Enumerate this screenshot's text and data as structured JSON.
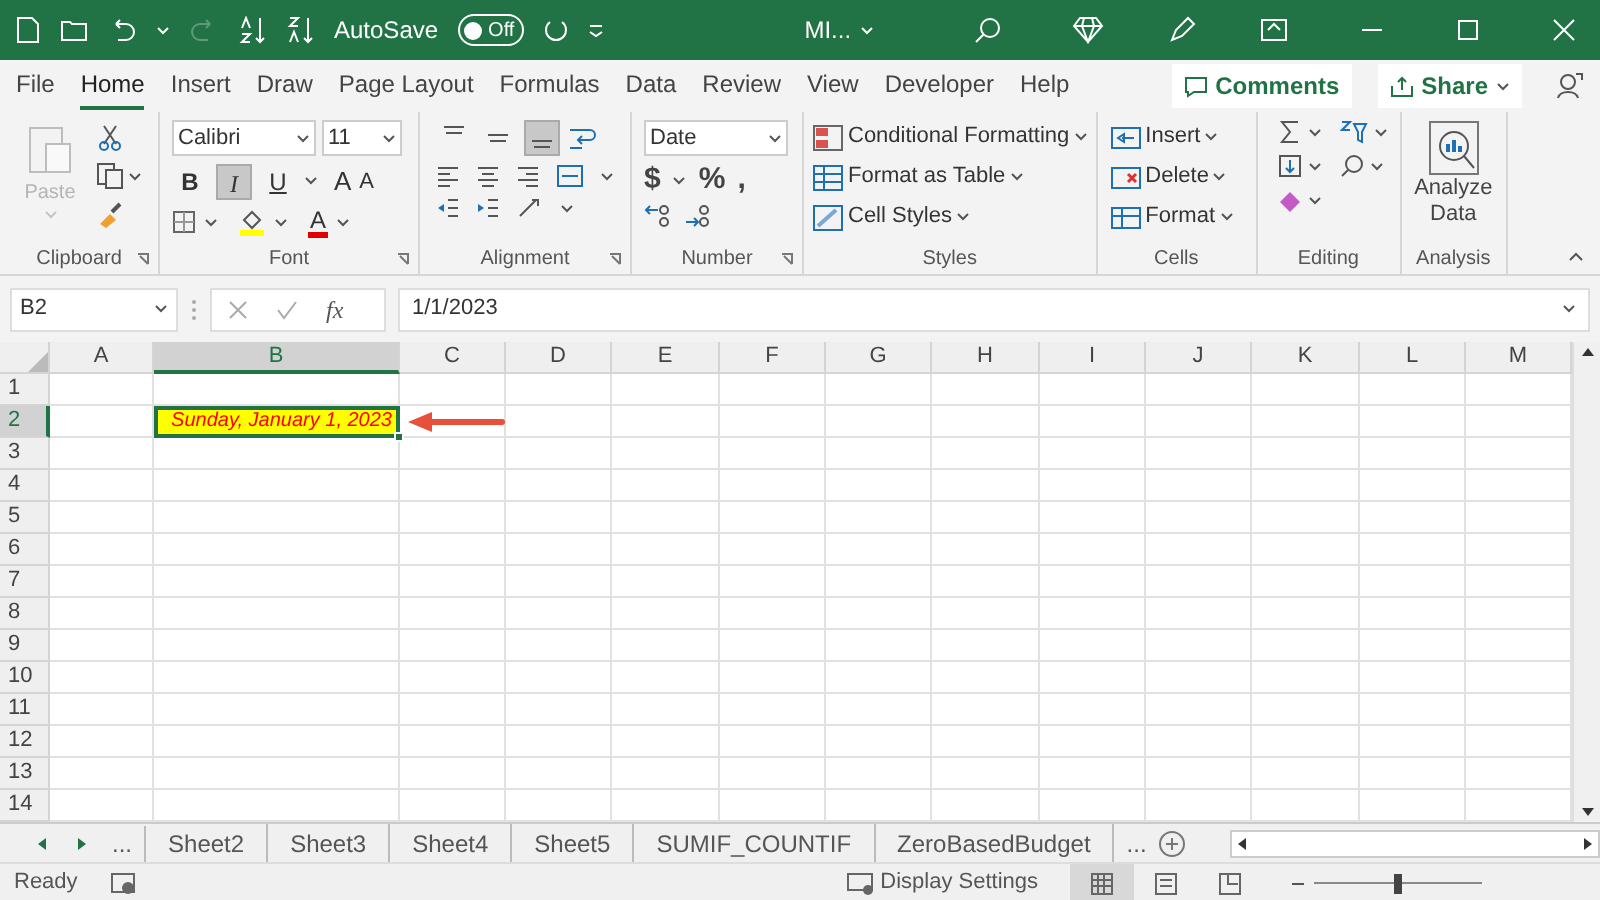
{
  "title_bar": {
    "autosave_label": "AutoSave",
    "autosave": {
      "on": false,
      "label": "Off"
    },
    "document_title": "MI..."
  },
  "menu_tabs": [
    {
      "label": "File",
      "selected": false
    },
    {
      "label": "Home",
      "selected": true
    },
    {
      "label": "Insert",
      "selected": false
    },
    {
      "label": "Draw",
      "selected": false
    },
    {
      "label": "Page Layout",
      "selected": false
    },
    {
      "label": "Formulas",
      "selected": false
    },
    {
      "label": "Data",
      "selected": false
    },
    {
      "label": "Review",
      "selected": false
    },
    {
      "label": "View",
      "selected": false
    },
    {
      "label": "Developer",
      "selected": false
    },
    {
      "label": "Help",
      "selected": false
    }
  ],
  "comments_button": "Comments",
  "share_button": "Share",
  "ribbon": {
    "clipboard": {
      "label": "Clipboard",
      "paste": {
        "label": "Paste",
        "disabled": true
      }
    },
    "font": {
      "label": "Font",
      "font_name": "Calibri",
      "font_size": "11",
      "styles": [
        {
          "label": "B",
          "selected": false
        },
        {
          "label": "I",
          "selected": true
        },
        {
          "label": "U",
          "selected": false
        }
      ],
      "grow_font": "A",
      "shrink_font": "A",
      "font_color": "A"
    },
    "alignment": {
      "label": "Alignment",
      "vertical": [
        {
          "selected": false
        },
        {
          "selected": false
        },
        {
          "selected": true
        }
      ]
    },
    "number": {
      "label": "Number",
      "format": "Date",
      "symbols": [
        "$",
        "%",
        ","
      ]
    },
    "styles": {
      "label": "Styles",
      "buttons": [
        "Conditional Formatting",
        "Format as Table",
        "Cell Styles"
      ]
    },
    "cells": {
      "label": "Cells",
      "buttons": [
        "Insert",
        "Delete",
        "Format"
      ]
    },
    "editing": {
      "label": "Editing"
    },
    "analysis": {
      "label": "Analysis",
      "button": "Analyze Data"
    }
  },
  "formula_bar": {
    "name_box": "B2",
    "function_label": "fx",
    "formula": "1/1/2023"
  },
  "sheet": {
    "columns": [
      {
        "label": "A",
        "selected": false
      },
      {
        "label": "B",
        "selected": true
      },
      {
        "label": "C",
        "selected": false
      },
      {
        "label": "D",
        "selected": false
      },
      {
        "label": "E",
        "selected": false
      },
      {
        "label": "F",
        "selected": false
      },
      {
        "label": "G",
        "selected": false
      },
      {
        "label": "H",
        "selected": false
      },
      {
        "label": "I",
        "selected": false
      },
      {
        "label": "J",
        "selected": false
      },
      {
        "label": "K",
        "selected": false
      },
      {
        "label": "L",
        "selected": false
      },
      {
        "label": "M",
        "selected": false
      }
    ],
    "rows": [
      {
        "label": "1",
        "selected": false
      },
      {
        "label": "2",
        "selected": true
      },
      {
        "label": "3",
        "selected": false
      },
      {
        "label": "4",
        "selected": false
      },
      {
        "label": "5",
        "selected": false
      },
      {
        "label": "6",
        "selected": false
      },
      {
        "label": "7",
        "selected": false
      },
      {
        "label": "8",
        "selected": false
      },
      {
        "label": "9",
        "selected": false
      },
      {
        "label": "10",
        "selected": false
      },
      {
        "label": "11",
        "selected": false
      },
      {
        "label": "12",
        "selected": false
      },
      {
        "label": "13",
        "selected": false
      },
      {
        "label": "14",
        "selected": false
      }
    ],
    "active_cell_text": "Sunday, January 1, 2023"
  },
  "sheet_tabs_more_left": "...",
  "sheet_tabs": [
    {
      "label": "Sheet2",
      "selected": false
    },
    {
      "label": "Sheet3",
      "selected": false
    },
    {
      "label": "Sheet4",
      "selected": false
    },
    {
      "label": "Sheet5",
      "selected": false
    },
    {
      "label": "SUMIF_COUNTIF",
      "selected": false
    },
    {
      "label": "ZeroBasedBudget",
      "selected": false
    }
  ],
  "sheet_tabs_more_right": "...",
  "status_bar": {
    "status": "Ready",
    "display_settings": "Display Settings",
    "views": [
      {
        "selected": true
      },
      {
        "selected": false
      },
      {
        "selected": false
      }
    ],
    "zoom": {
      "level": 0.5
    }
  }
}
